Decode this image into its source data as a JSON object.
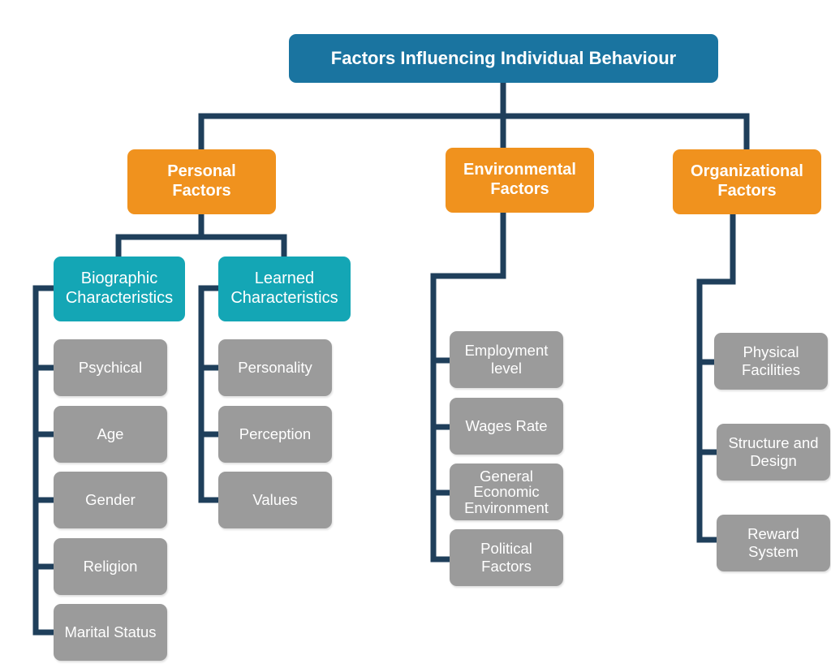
{
  "diagram": {
    "title": "Factors Influencing Individual Behaviour",
    "categories": {
      "personal": {
        "label": "Personal\nFactors",
        "subgroups": {
          "biographic": {
            "label": "Biographic\nCharacteristics",
            "items": [
              "Psychical",
              "Age",
              "Gender",
              "Religion",
              "Marital Status"
            ]
          },
          "learned": {
            "label": "Learned\nCharacteristics",
            "items": [
              "Personality",
              "Perception",
              "Values"
            ]
          }
        }
      },
      "environmental": {
        "label": "Environmental\nFactors",
        "items": [
          "Employment\nlevel",
          "Wages Rate",
          "General\nEconomic\nEnvironment",
          "Political\nFactors"
        ]
      },
      "organizational": {
        "label": "Organizational\nFactors",
        "items": [
          "Physical\nFacilities",
          "Structure and\nDesign",
          "Reward\nSystem"
        ]
      }
    },
    "colors": {
      "title": "#1a74a0",
      "category": "#f0921e",
      "subgroup": "#14a6b5",
      "leaf": "#9b9b9b",
      "connector": "#1f3f5b"
    }
  }
}
